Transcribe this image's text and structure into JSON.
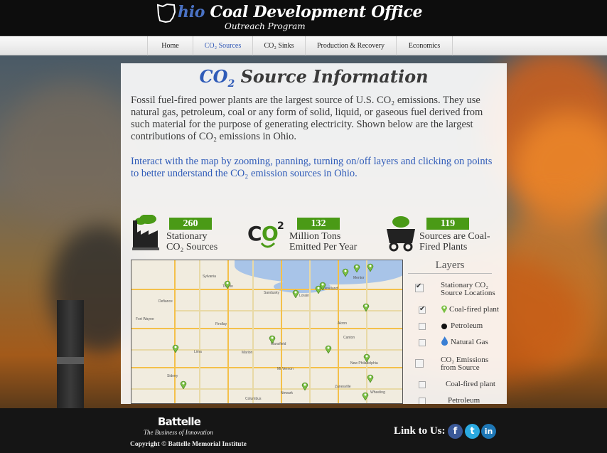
{
  "header": {
    "title_first_letter_icon": "ohio-state-outline-icon",
    "title_hio": "hio",
    "title_rest": " Coal Development Office",
    "subtitle": "Outreach Program"
  },
  "nav": {
    "items": [
      {
        "label": "Home",
        "active": false
      },
      {
        "label": "CO₂ Sources",
        "active": true
      },
      {
        "label": "CO₂ Sinks",
        "active": false
      },
      {
        "label": "Production & Recovery",
        "active": false
      },
      {
        "label": "Economics",
        "active": false
      }
    ]
  },
  "main": {
    "title_co": "CO",
    "title_sub": "2",
    "title_rest": " Source Information",
    "intro": "Fossil fuel-fired power plants are the largest source of U.S. CO₂ emissions. They use natural gas, petroleum, coal or any form of solid, liquid, or gaseous fuel derived from such material for the purpose of generating electricity. Shown below are the largest contributions of CO₂ emissions in Ohio.",
    "interact": "Interact with the map by zooming, panning, turning on/off layers and clicking on points to better understand the CO₂ emission sources in Ohio.",
    "stats": [
      {
        "value": "260",
        "line1": "Stationary",
        "line2": "CO₂ Sources",
        "icon": "factory-icon"
      },
      {
        "value": "132",
        "line1": "Million Tons",
        "line2": "Emitted Per Year",
        "icon": "co2-cloud-icon"
      },
      {
        "value": "119",
        "line1": "Sources are Coal-",
        "line2": "Fired Plants",
        "icon": "coal-cart-icon"
      }
    ]
  },
  "map": {
    "labels": [
      "Sylvania",
      "Toledo",
      "Sandusky",
      "Lorain",
      "Cleveland",
      "Mentor",
      "Findlay",
      "Akron",
      "Canton",
      "Lima",
      "Mansfield",
      "Marion",
      "Fort Wayne",
      "New Philadelphia",
      "Mt Vernon",
      "Zanesville",
      "Columbus",
      "Newark",
      "Wheeling",
      "Sidney",
      "Defiance"
    ]
  },
  "layers": {
    "title": "Layers",
    "items": [
      {
        "label_a": "Stationary CO₂",
        "label_b": "Source Locations",
        "checked": true
      },
      {
        "label": "Coal-fired plant",
        "checked": true,
        "icon": "green-map-pin-icon"
      },
      {
        "label": "Petroleum",
        "checked": false,
        "icon": "black-dot-icon"
      },
      {
        "label": "Natural Gas",
        "checked": false,
        "icon": "blue-flame-icon"
      },
      {
        "label_a": "CO₂ Emissions",
        "label_b": "from Source",
        "checked": false
      },
      {
        "label": "Coal-fired plant",
        "checked": false
      },
      {
        "label": "Petroleum",
        "checked": false
      }
    ]
  },
  "footer": {
    "brand": "Battelle",
    "tagline": "The Business of Innovation",
    "copyright": "Copyright © Battelle Memorial Institute",
    "link_to_us": "Link to Us:",
    "social": [
      {
        "icon": "facebook-icon",
        "glyph": "f",
        "color": "#3b5998"
      },
      {
        "icon": "twitter-icon",
        "glyph": "t",
        "color": "#2aa9e0"
      },
      {
        "icon": "linkedin-icon",
        "glyph": "in",
        "color": "#1e77b5"
      }
    ]
  }
}
